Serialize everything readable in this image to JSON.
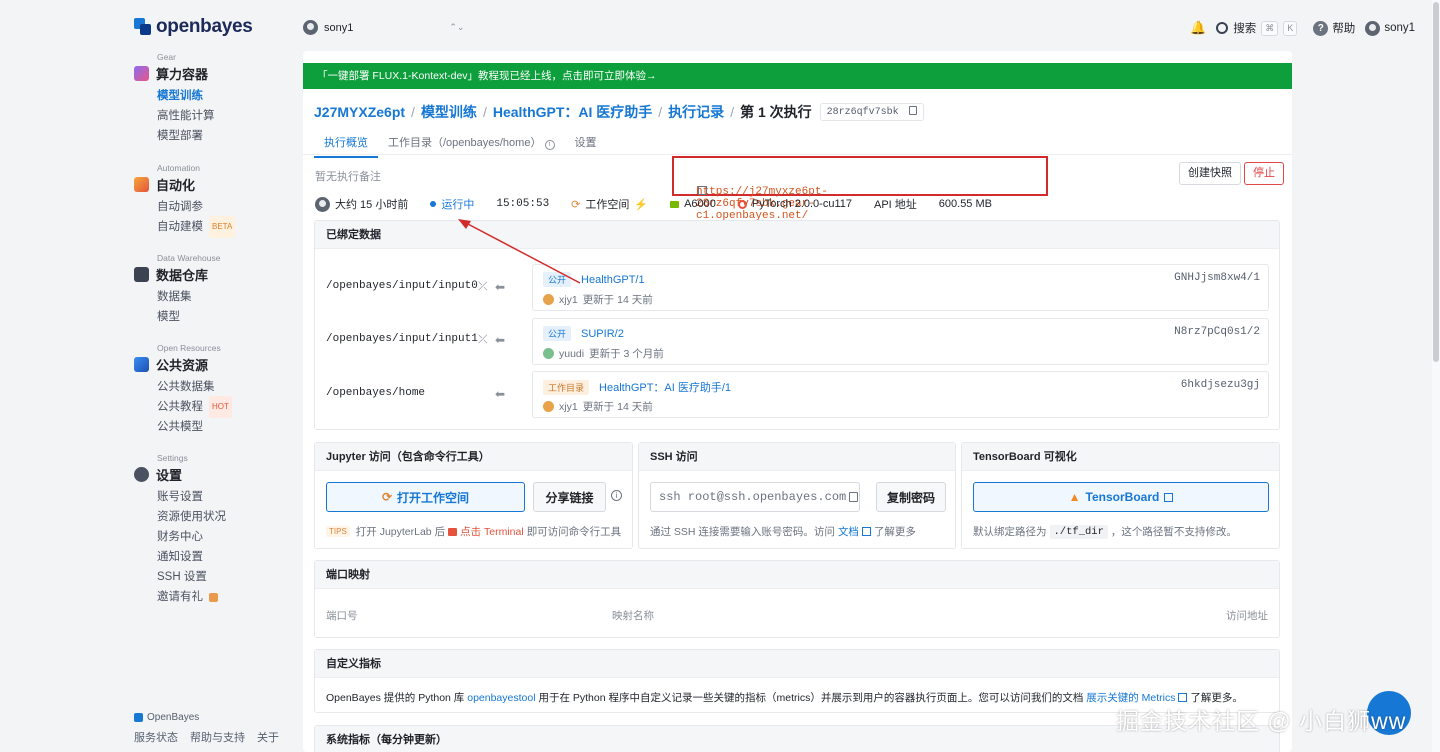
{
  "brand": {
    "name": "openbayes",
    "footer_name": "OpenBayes",
    "footer_links": [
      "服务状态",
      "帮助与支持",
      "关于"
    ]
  },
  "workspace": {
    "user": "sony1"
  },
  "topbar": {
    "search_label": "搜索",
    "kbd1": "⌘",
    "kbd2": "K",
    "help_label": "帮助",
    "user": "sony1"
  },
  "sidebar": {
    "gear": {
      "sub": "Gear",
      "title": "算力容器",
      "items": [
        "模型训练",
        "高性能计算",
        "模型部署"
      ]
    },
    "automation": {
      "sub": "Automation",
      "title": "自动化",
      "items": [
        "自动调参",
        "自动建模"
      ],
      "beta": "BETA"
    },
    "warehouse": {
      "sub": "Data Warehouse",
      "title": "数据仓库",
      "items": [
        "数据集",
        "模型"
      ]
    },
    "resources": {
      "sub": "Open Resources",
      "title": "公共资源",
      "items": [
        "公共数据集",
        "公共教程",
        "公共模型"
      ],
      "hot": "HOT"
    },
    "settings": {
      "sub": "Settings",
      "title": "设置",
      "items": [
        "账号设置",
        "资源使用状况",
        "财务中心",
        "通知设置",
        "SSH 设置",
        "邀请有礼"
      ]
    }
  },
  "banner": "「一键部署 FLUX.1-Kontext-dev」教程现已经上线，点击即可立即体验→",
  "breadcrumb": {
    "project": "J27MYXZe6pt",
    "section": "模型训练",
    "name": "HealthGPT：AI 医疗助手",
    "records": "执行记录",
    "current": "第 1 次执行",
    "hash": "28rz6qfv7sbk"
  },
  "tabs": [
    "执行概览",
    "工作目录（/openbayes/home）",
    "设置"
  ],
  "note": "暂无执行备注",
  "url": "https://j27myxze6pt-28rz6qfv7sbk.gear-c1.openbayes.net/",
  "buttons": {
    "snapshot": "创建快照",
    "stop": "停止"
  },
  "stats": {
    "duration": "大约 15 小时前",
    "status": "运行中",
    "time": "15:05:53",
    "workspace": "工作空间",
    "gpu": "A6000",
    "framework": "PyTorch 2.0.0-cu117",
    "api": "API 地址",
    "memory": "600.55 MB"
  },
  "bound_data": {
    "title": "已绑定数据",
    "rows": [
      {
        "path": "/openbayes/input/input0",
        "badge": "公开",
        "name": "HealthGPT/1",
        "hash": "GNHJjsm8xw4/1",
        "user": "xjy1",
        "updated": "更新于 14 天前"
      },
      {
        "path": "/openbayes/input/input1",
        "badge": "公开",
        "name": "SUPIR/2",
        "hash": "N8rz7pCq0s1/2",
        "user": "yuudi",
        "updated": "更新于 3 个月前"
      },
      {
        "path": "/openbayes/home",
        "badge": "工作目录",
        "name": "HealthGPT：AI 医疗助手/1",
        "hash": "6hkdjsezu3gj",
        "user": "xjy1",
        "updated": "更新于 14 天前"
      }
    ]
  },
  "jupyter": {
    "title": "Jupyter 访问（包含命令行工具）",
    "open_btn": "打开工作空间",
    "share_btn": "分享链接",
    "tips": "TIPS",
    "tip_a": "打开 JupyterLab 后",
    "tip_b": "点击 Terminal",
    "tip_c": "即可访问命令行工具"
  },
  "ssh": {
    "title": "SSH 访问",
    "command": "ssh root@ssh.openbayes.com",
    "copy_btn": "复制密码",
    "desc_a": "通过 SSH 连接需要输入账号密码。访问",
    "doc": "文档",
    "desc_b": "了解更多"
  },
  "tensorboard": {
    "title": "TensorBoard 可视化",
    "btn": "TensorBoard",
    "desc_a": "默认绑定路径为",
    "path": "./tf_dir",
    "desc_b": "，这个路径暂不支持修改。"
  },
  "ports": {
    "title": "端口映射",
    "cols": [
      "端口号",
      "映射名称",
      "访问地址"
    ]
  },
  "metrics": {
    "title": "自定义指标",
    "text_a": "OpenBayes 提供的 Python 库",
    "lib": "openbayestool",
    "text_b": "用于在 Python 程序中自定义记录一些关键的指标（metrics）并展示到用户的容器执行页面上。您可以访问我们的文档",
    "link": "展示关键的 Metrics",
    "text_c": "了解更多。"
  },
  "system_metrics": {
    "title": "系统指标（每分钟更新）"
  },
  "watermark": "掘金技术社区 @ 小白狮ww"
}
